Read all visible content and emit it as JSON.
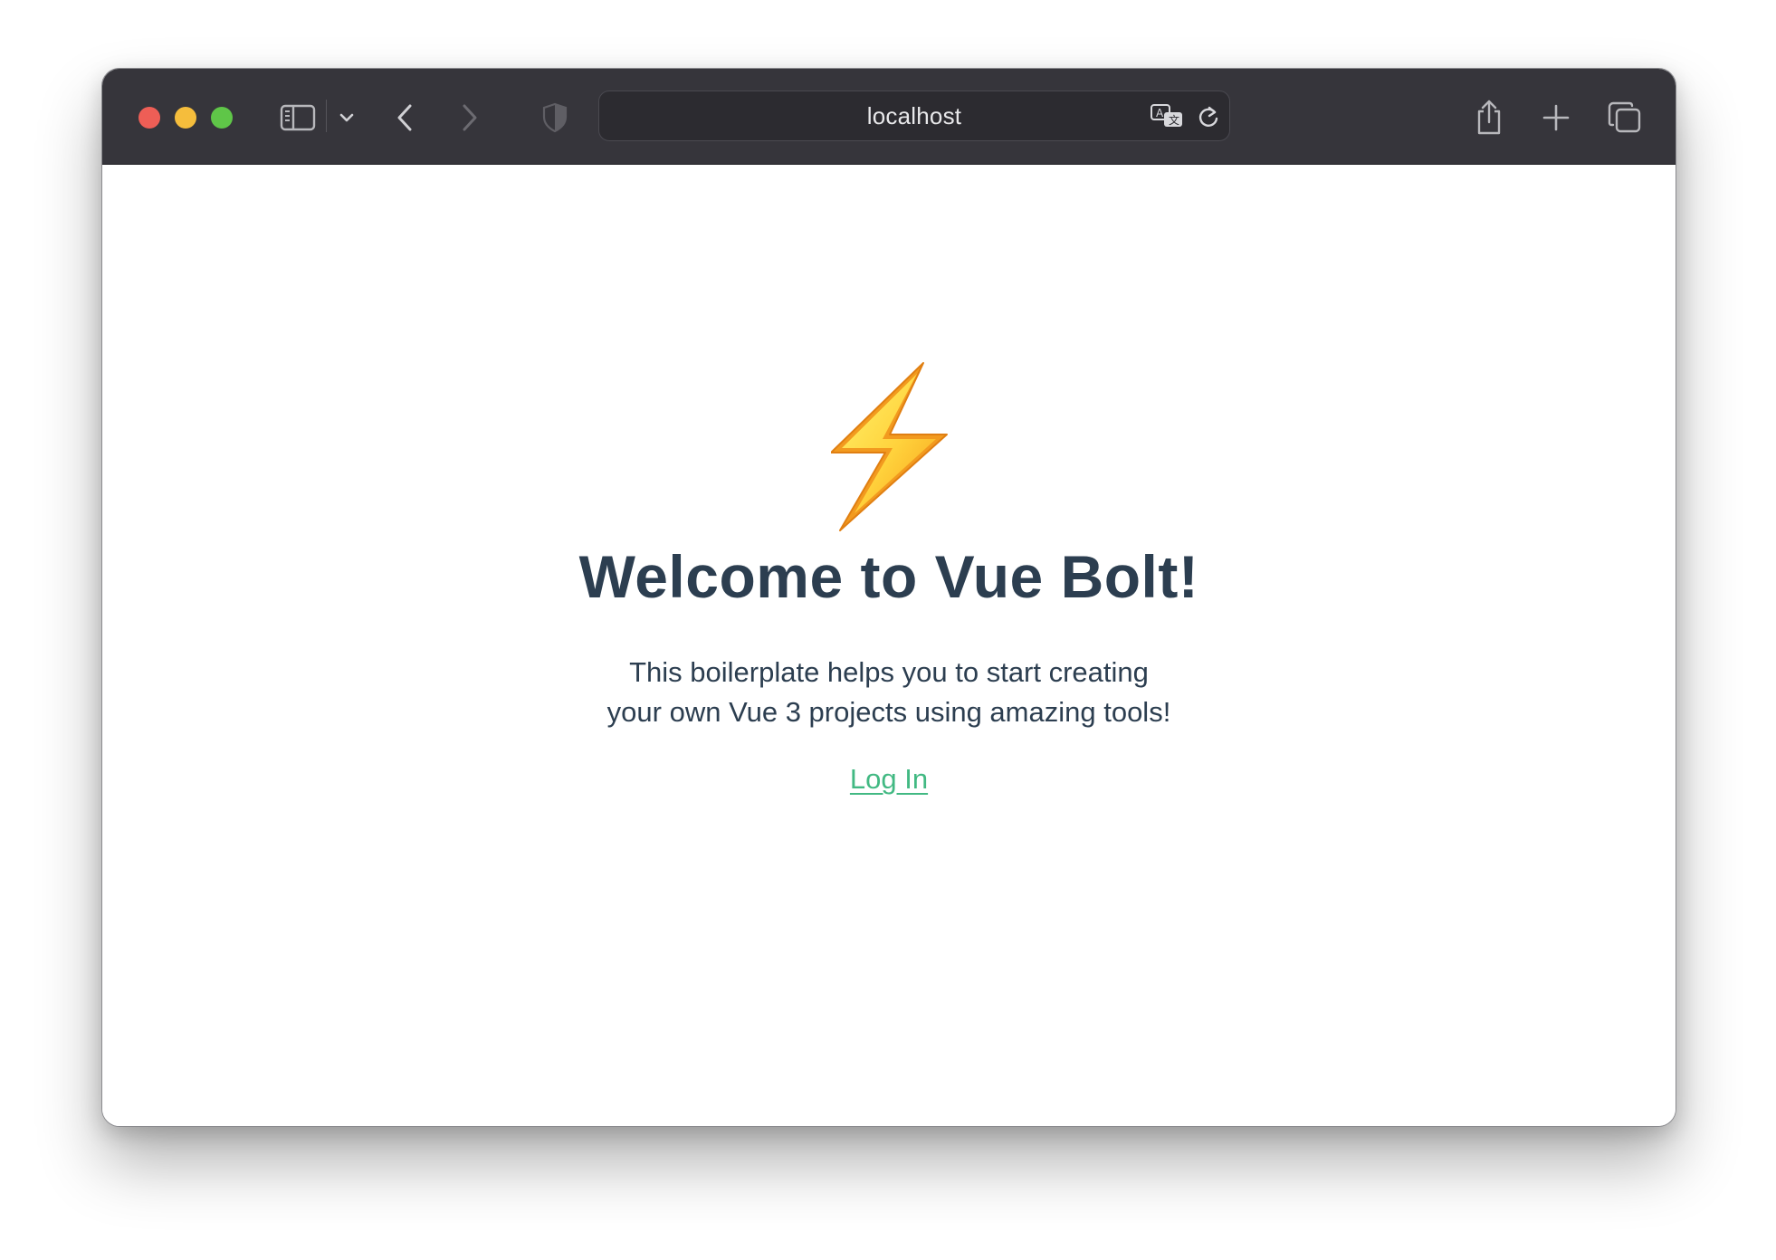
{
  "browser": {
    "address_bar": {
      "url_text": "localhost"
    },
    "traffic_lights": {
      "close_color": "#ee5e56",
      "minimize_color": "#f5bd3c",
      "zoom_color": "#5fc648"
    },
    "toolbar_icons": [
      "sidebar-icon",
      "chevron-down-icon",
      "back-icon",
      "forward-icon",
      "privacy-shield-icon",
      "translate-icon",
      "reload-icon",
      "share-icon",
      "new-tab-icon",
      "tab-overview-icon"
    ],
    "toolbar_color": "#36353b"
  },
  "page": {
    "logo_icon": "lightning-bolt-icon",
    "title": "Welcome to Vue Bolt!",
    "description_line1": "This boilerplate helps you to start creating",
    "description_line2": "your own Vue 3 projects using amazing tools!",
    "login_link": "Log In",
    "text_color": "#2c3e50",
    "link_color": "#42b983"
  }
}
